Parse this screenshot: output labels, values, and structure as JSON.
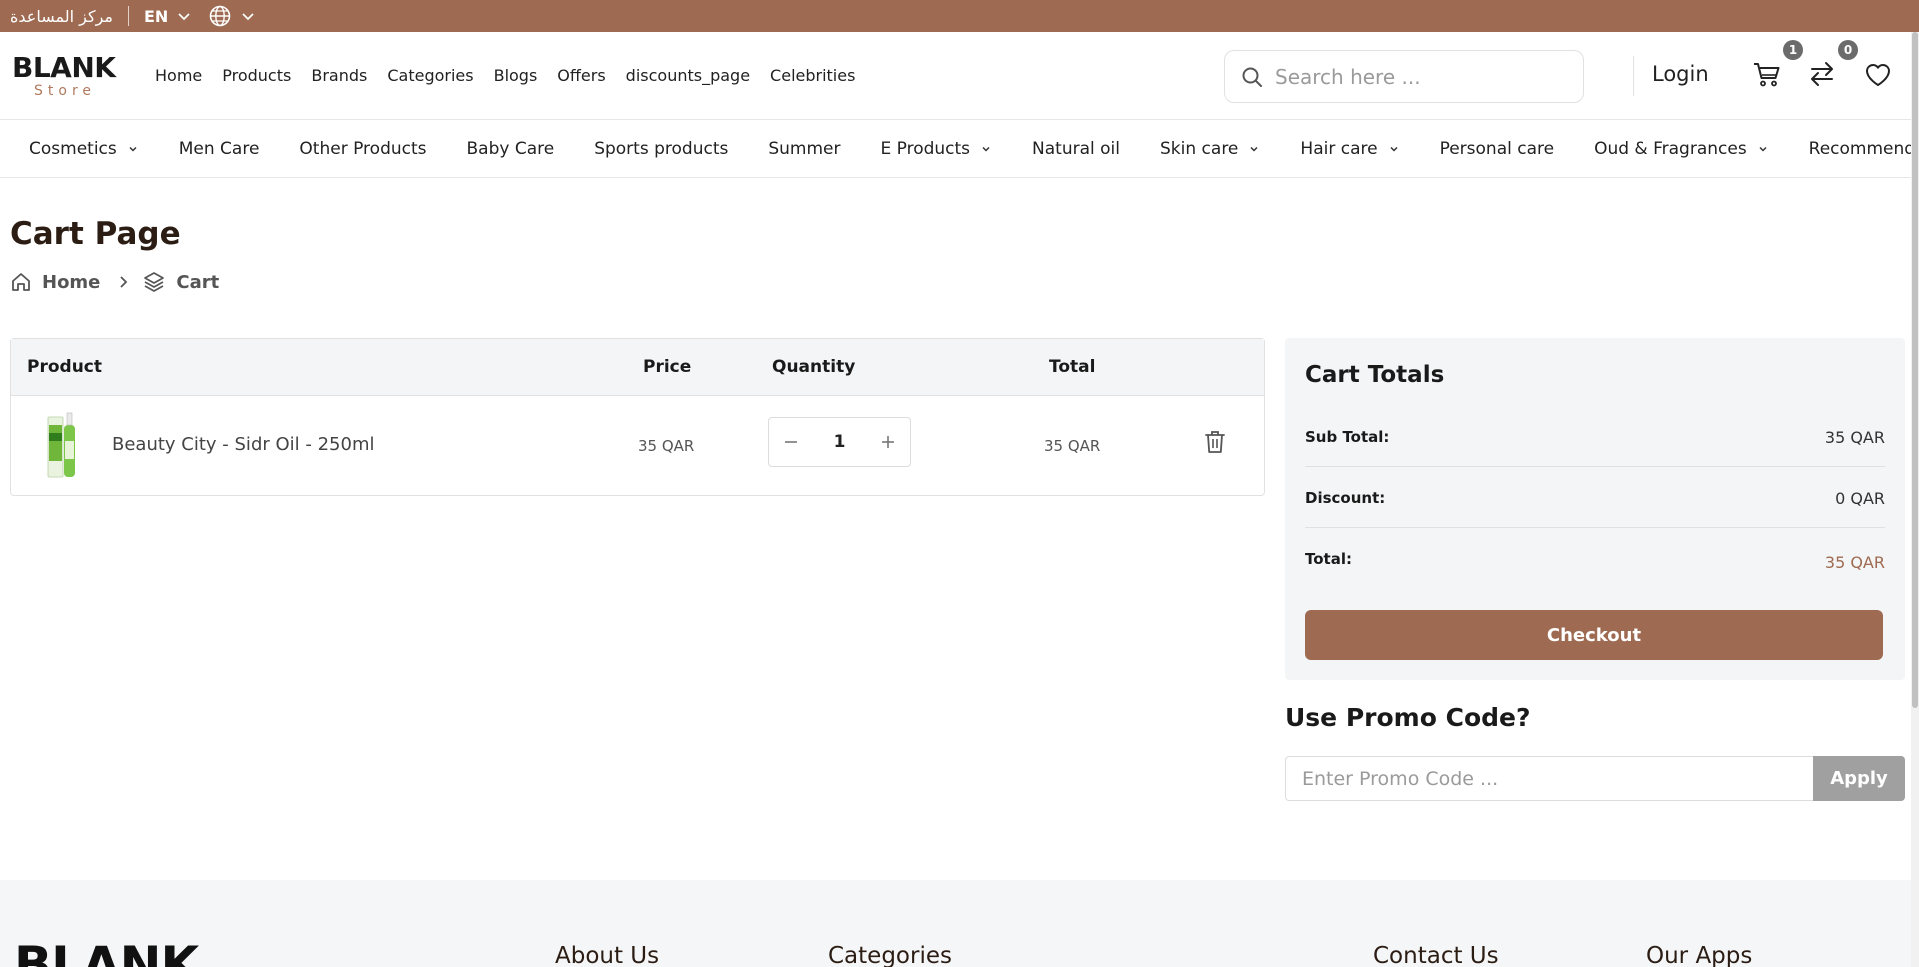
{
  "topbar": {
    "help_center": "مركز المساعدة",
    "language": "EN"
  },
  "header": {
    "logo_main": "BLANK",
    "logo_sub": "Store",
    "nav": [
      "Home",
      "Products",
      "Brands",
      "Categories",
      "Blogs",
      "Offers",
      "discounts_page",
      "Celebrities"
    ],
    "search_placeholder": "Search here ...",
    "login": "Login",
    "cart_count": "1",
    "compare_count": "0"
  },
  "categories": [
    {
      "label": "Cosmetics",
      "dropdown": true
    },
    {
      "label": "Men Care",
      "dropdown": false
    },
    {
      "label": "Other Products",
      "dropdown": false
    },
    {
      "label": "Baby Care",
      "dropdown": false
    },
    {
      "label": "Sports products",
      "dropdown": false
    },
    {
      "label": "Summer",
      "dropdown": false
    },
    {
      "label": "E Products",
      "dropdown": true
    },
    {
      "label": "Natural oil",
      "dropdown": false
    },
    {
      "label": "Skin care",
      "dropdown": true
    },
    {
      "label": "Hair care",
      "dropdown": true
    },
    {
      "label": "Personal care",
      "dropdown": false
    },
    {
      "label": "Oud & Fragrances",
      "dropdown": true
    },
    {
      "label": "Recommended",
      "dropdown": false
    }
  ],
  "page": {
    "title": "Cart Page",
    "breadcrumb_home": "Home",
    "breadcrumb_current": "Cart"
  },
  "cart": {
    "headers": {
      "product": "Product",
      "price": "Price",
      "quantity": "Quantity",
      "total": "Total"
    },
    "items": [
      {
        "name": "Beauty City - Sidr Oil - 250ml",
        "price": "35 QAR",
        "quantity": "1",
        "total": "35 QAR"
      }
    ]
  },
  "totals": {
    "title": "Cart Totals",
    "subtotal_label": "Sub Total:",
    "subtotal_value": "35 QAR",
    "discount_label": "Discount:",
    "discount_value": "0 QAR",
    "total_label": "Total:",
    "total_value": "35 QAR",
    "checkout": "Checkout"
  },
  "promo": {
    "title": "Use Promo Code?",
    "placeholder": "Enter Promo Code ...",
    "apply": "Apply"
  },
  "footer": {
    "brand": "BLANK",
    "headings": [
      "About Us",
      "Categories",
      "Contact Us",
      "Our Apps"
    ]
  },
  "colors": {
    "brand": "#9e6a51",
    "panel": "#f4f5f6"
  }
}
